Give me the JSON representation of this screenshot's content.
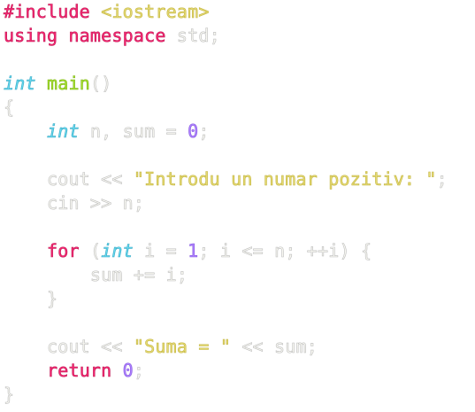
{
  "colors": {
    "background": "#ffffff",
    "keyword": "#f92672",
    "type": "#66d9ef",
    "function": "#a6e22e",
    "string": "#e6db74",
    "number": "#ae81ff",
    "plain": "#f8f8f2"
  },
  "code": {
    "line1": {
      "include": "#include",
      "space": " ",
      "header": "<iostream>"
    },
    "line2": {
      "using_namespace": "using namespace",
      "rest": " std;"
    },
    "line4": {
      "type": "int",
      "space": " ",
      "func": "main",
      "parens": "()"
    },
    "line5": {
      "brace": "{"
    },
    "line6": {
      "indent": "    ",
      "type": "int",
      "decl": " n, sum = ",
      "num": "0",
      "semi": ";"
    },
    "line8": {
      "pre": "    cout << ",
      "str": "\"Introdu un numar pozitiv: \"",
      "semi": ";"
    },
    "line9": {
      "text": "    cin >> n;"
    },
    "line11": {
      "indent": "    ",
      "kw": "for",
      "open": " (",
      "type": "int",
      "mid": " i = ",
      "num": "1",
      "rest": "; i <= n; ++i) {"
    },
    "line12": {
      "text": "        sum += i;"
    },
    "line13": {
      "text": "    }"
    },
    "line15": {
      "pre": "    cout << ",
      "str": "\"Suma = \"",
      "rest": " << sum;"
    },
    "line16": {
      "indent": "    ",
      "kw": "return",
      "space": " ",
      "num": "0",
      "semi": ";"
    },
    "line17": {
      "brace": "}"
    }
  }
}
